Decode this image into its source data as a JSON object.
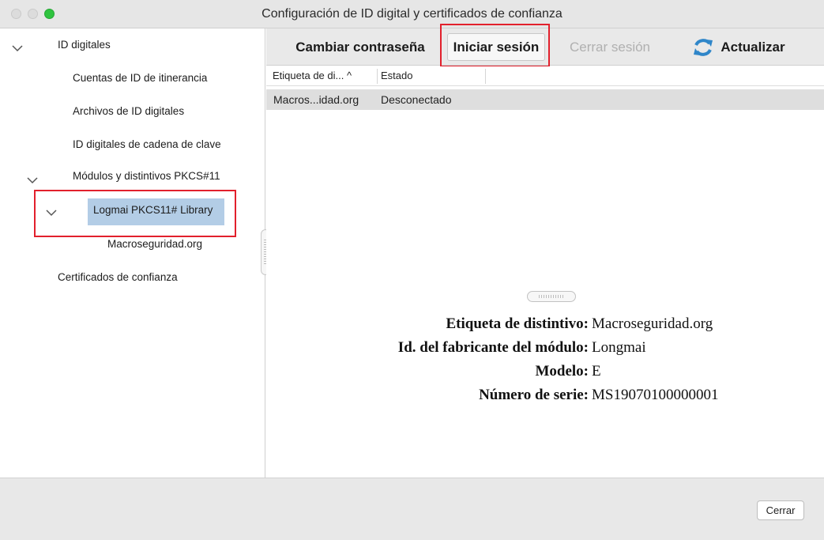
{
  "window": {
    "title": "Configuración de ID digital y certificados de confianza"
  },
  "sidebar": {
    "root_label": "ID digitales",
    "items": [
      {
        "label": "Cuentas de ID de itinerancia"
      },
      {
        "label": "Archivos de ID digitales"
      },
      {
        "label": "ID digitales de cadena de clave"
      },
      {
        "label": "Módulos y distintivos PKCS#11"
      },
      {
        "label": "Logmai PKCS11# Library"
      },
      {
        "label": "Macroseguridad.org"
      }
    ],
    "trusted_certs_label": "Certificados de confianza"
  },
  "toolbar": {
    "change_password": "Cambiar contraseña",
    "login": "Iniciar sesión",
    "logout": "Cerrar sesión",
    "refresh": "Actualizar"
  },
  "table": {
    "columns": [
      "Etiqueta de di... ^",
      "Estado"
    ],
    "rows": [
      [
        "Macros...idad.org",
        "Desconectado"
      ]
    ]
  },
  "details": [
    {
      "label": "Etiqueta de distintivo:",
      "value": "Macroseguridad.org"
    },
    {
      "label": "Id. del fabricante del módulo:",
      "value": "Longmai"
    },
    {
      "label": "Modelo:",
      "value": "E"
    },
    {
      "label": "Número de serie:",
      "value": "MS19070100000001"
    }
  ],
  "footer": {
    "close_label": "Cerrar"
  },
  "colors": {
    "selection": "#b3cde6",
    "highlight_box": "#e2202c",
    "zoom_button": "#2fc33f",
    "refresh_icon": "#2f86c9"
  },
  "icons": {
    "refresh": "refresh-icon",
    "disclosure": "chevron-down-icon"
  }
}
